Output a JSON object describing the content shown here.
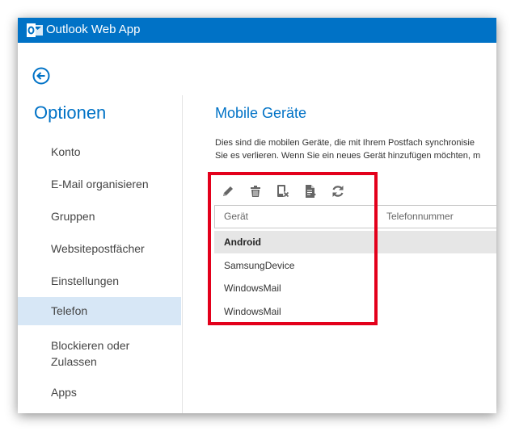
{
  "header": {
    "app_title": "Outlook Web App",
    "logo_icon": "outlook-logo-icon",
    "bar_color": "#0072c6"
  },
  "back_icon": "back-arrow-icon",
  "sidebar": {
    "title": "Optionen",
    "items": [
      {
        "label": "Konto"
      },
      {
        "label": "E-Mail organisieren"
      },
      {
        "label": "Gruppen"
      },
      {
        "label": "Websitepostfächer"
      },
      {
        "label": "Einstellungen"
      },
      {
        "label": "Telefon",
        "active": true
      },
      {
        "label": "Blockieren oder Zulassen"
      },
      {
        "label": "Apps"
      }
    ]
  },
  "content": {
    "title": "Mobile Geräte",
    "description_line1": "Dies sind die mobilen Geräte, die mit Ihrem Postfach synchronisie",
    "description_line2": "Sie es verlieren. Wenn Sie ein neues Gerät hinzufügen möchten, m",
    "toolbar": [
      {
        "name": "edit-icon"
      },
      {
        "name": "delete-icon"
      },
      {
        "name": "block-device-icon"
      },
      {
        "name": "details-icon"
      },
      {
        "name": "refresh-icon"
      }
    ],
    "table": {
      "columns": [
        "Gerät",
        "Telefonnummer"
      ],
      "rows": [
        {
          "device": "Android",
          "selected": true
        },
        {
          "device": "SamsungDevice"
        },
        {
          "device": "WindowsMail"
        },
        {
          "device": "WindowsMail"
        }
      ]
    }
  },
  "annotation": {
    "highlight_color": "#e3001b"
  }
}
